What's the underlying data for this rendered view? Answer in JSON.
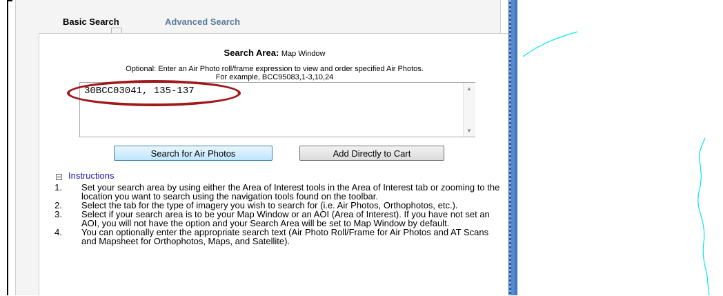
{
  "tabs": {
    "basic_label": "Basic Search",
    "advanced_label": "Advanced Search"
  },
  "search_area": {
    "title": "Search Area",
    "title_suffix": ": ",
    "value": "Map Window"
  },
  "optional_text": "Optional: Enter an Air Photo roll/frame expression to view and order specified Air Photos.",
  "example_text": "For example, BCC95083,1-3,10,24",
  "roll_frame_input": {
    "value": "30BCC03041, 135-137"
  },
  "buttons": {
    "search_label": "Search for Air Photos",
    "cart_label": "Add Directly to Cart"
  },
  "instructions": {
    "heading": "Instructions",
    "items": [
      {
        "num": "1.",
        "text": "Set your search area by using either the Area of Interest tools in the Area of Interest tab or zooming to the location you want to search using the navigation tools found on the toolbar."
      },
      {
        "num": "2.",
        "text": "Select the tab for the type of imagery you wish to search for (i.e. Air Photos, Orthophotos, etc.)."
      },
      {
        "num": "3.",
        "text": "Select if your search area is to be your Map Window or an AOI (Area of Interest). If you have not set an AOI, you will not have the option and your Search Area will be set to Map Window by default."
      },
      {
        "num": "4.",
        "text": "You can optionally enter the appropriate search text (Air Photo Roll/Frame for Air Photos and AT Scans and Mapsheet for Orthophotos, Maps, and Satellite)."
      }
    ]
  },
  "colors": {
    "highlight": "#a0191d",
    "inactive_tab": "#5a7b9a",
    "instructions_link": "#1a1aa6",
    "map_line": "#00e5f0",
    "map_divider": "#3b6fb8"
  },
  "icons": {
    "collapse": "minus-box-icon",
    "scroll_up": "triangle-up-icon",
    "scroll_down": "triangle-down-icon"
  }
}
